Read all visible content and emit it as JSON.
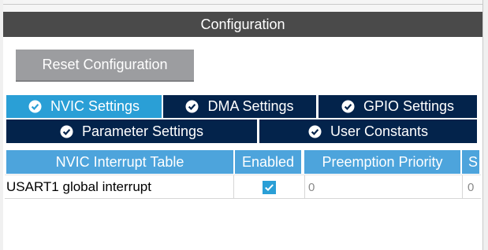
{
  "header": {
    "title": "Configuration"
  },
  "toolbar": {
    "reset_label": "Reset Configuration"
  },
  "tabs": [
    {
      "label": "NVIC Settings",
      "active": true
    },
    {
      "label": "DMA Settings",
      "active": false
    },
    {
      "label": "GPIO Settings",
      "active": false
    },
    {
      "label": "Parameter Settings",
      "active": false
    },
    {
      "label": "User Constants",
      "active": false
    }
  ],
  "table": {
    "columns": [
      "NVIC Interrupt Table",
      "Enabled",
      "Preemption Priority",
      "S"
    ],
    "rows": [
      {
        "name": "USART1 global interrupt",
        "enabled": true,
        "preemption_priority": "0",
        "sub_priority": "0"
      }
    ]
  },
  "colors": {
    "header_bar": "#4a4a4a",
    "tab_active": "#2a9fd6",
    "tab_inactive": "#03234b",
    "table_header": "#4da4dc",
    "button": "#9c9da0"
  },
  "icons": {
    "tab_check": "check-circle-icon",
    "enabled_check": "checkbox-checked-icon"
  }
}
